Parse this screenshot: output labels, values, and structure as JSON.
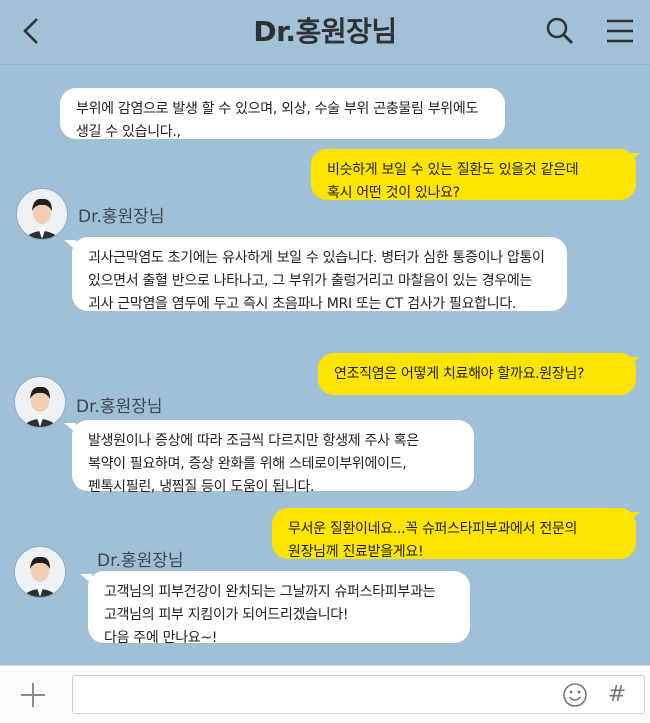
{
  "header": {
    "title": "Dr.홍원장님",
    "back_icon": "chevron-left-icon",
    "search_icon": "search-icon",
    "menu_icon": "menu-icon"
  },
  "messages": [
    {
      "type": "in",
      "text": "부위에 감염으로 발생 할 수 있으며, 외상, 수술 부위 곤충물림 부위에도\n생길 수 있습니다.,"
    },
    {
      "type": "out",
      "text": "비슷하게 보일 수 있는 질환도 있을것 같은데\n혹시 어떤 것이 있나요?"
    },
    {
      "type": "sender",
      "name": "Dr.홍원장님"
    },
    {
      "type": "in",
      "text": "괴사근막염도 초기에는 유사하게 보일 수 있습니다. 병터가 심한 통증이나 압통이\n있으면서 출혈 반으로 나타나고, 그 부위가 출렁거리고 마찰음이 있는 경우에는\n괴사 근막염을 염두에 두고 즉시 초음파나 MRI 또는 CT 검사가 필요합니다."
    },
    {
      "type": "out",
      "text": "연조직염은 어떻게 치료해야 할까요.원장님?"
    },
    {
      "type": "sender",
      "name": "Dr.홍원장님"
    },
    {
      "type": "in",
      "text": "발생원이나 증상에 따라 조금씩 다르지만 항생제 주사 혹은\n복약이 필요하며, 증상 완화를 위해 스테로이부위에이드,\n펜톡시필린, 냉찜질 등이 도움이 됩니다."
    },
    {
      "type": "out",
      "text": "무서운 질환이네요...꼭 슈퍼스타피부과에서 전문의\n원장님께 진료받을게요!"
    },
    {
      "type": "sender",
      "name": "Dr.홍원장님"
    },
    {
      "type": "in",
      "text": "고객님의 피부건강이 완치되는 그날까지 슈퍼스타피부과는\n고객님의 피부 지킴이가 되어드리겠습니다!\n다음 주에 만나요~!"
    }
  ],
  "footer": {
    "plus_icon": "plus-icon",
    "emoji_icon": "emoji-icon",
    "hash_label": "#",
    "input_value": ""
  },
  "colors": {
    "background": "#a0c0d7",
    "incoming_bubble": "#ffffff",
    "outgoing_bubble": "#fee500"
  }
}
